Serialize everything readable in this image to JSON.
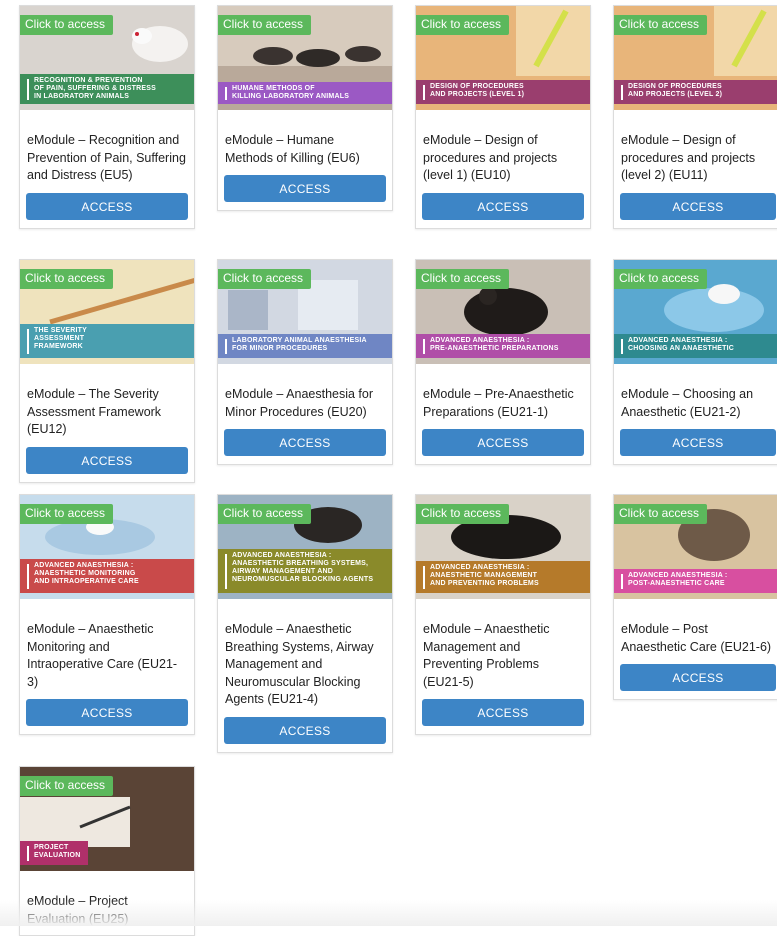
{
  "cards": [
    {
      "badge": "Click to access",
      "band": [
        "RECOGNITION & PREVENTION",
        "OF PAIN, SUFFERING & DISTRESS",
        "IN LABORATORY ANIMALS"
      ],
      "title": "eModule – Recognition and Prevention of Pain, Suffering and Distress (EU5)",
      "button": "ACCESS",
      "colors": {
        "bg": "#d9d4cf",
        "band": "#3d8f5a"
      }
    },
    {
      "badge": "Click to access",
      "band": [
        "HUMANE METHODS OF",
        "KILLING LABORATORY ANIMALS"
      ],
      "title": "eModule – Humane Methods of Killing (EU6)",
      "button": "ACCESS",
      "colors": {
        "bg": "#b9a99a",
        "band": "#9b59c4"
      }
    },
    {
      "badge": "Click to access",
      "band": [
        "DESIGN OF PROCEDURES",
        "AND PROJECTS (LEVEL 1)"
      ],
      "title": "eModule – Design of procedures and projects (level 1) (EU10)",
      "button": "ACCESS",
      "colors": {
        "bg": "#e8c27a",
        "band": "#9a3e6e"
      }
    },
    {
      "badge": "Click to access",
      "band": [
        "DESIGN OF PROCEDURES",
        "AND PROJECTS (LEVEL 2)"
      ],
      "title": "eModule – Design of procedures and projects (level 2) (EU11)",
      "button": "ACCESS",
      "colors": {
        "bg": "#e8c27a",
        "band": "#9a3e6e"
      }
    },
    {
      "badge": "Click to access",
      "band": [
        "THE SEVERITY",
        "ASSESSMENT",
        "FRAMEWORK"
      ],
      "title": "eModule – The Severity Assessment Framework (EU12)",
      "button": "ACCESS",
      "colors": {
        "bg": "#e9d9a8",
        "band": "#4a9fb0"
      }
    },
    {
      "badge": "Click to access",
      "band": [
        "LABORATORY ANIMAL ANAESTHESIA",
        "FOR MINOR PROCEDURES"
      ],
      "title": "eModule – Anaesthesia for Minor Procedures (EU20)",
      "button": "ACCESS",
      "colors": {
        "bg": "#c6ccd8",
        "band": "#6f86c4"
      }
    },
    {
      "badge": "Click to access",
      "band": [
        "ADVANCED ANAESTHESIA :",
        "PRE-ANAESTHETIC PREPARATIONS"
      ],
      "title": "eModule – Pre-Anaesthetic Preparations (EU21-1)",
      "button": "ACCESS",
      "colors": {
        "bg": "#7a6658",
        "band": "#b04ea8"
      }
    },
    {
      "badge": "Click to access",
      "band": [
        "ADVANCED ANAESTHESIA :",
        "CHOOSING AN ANAESTHETIC"
      ],
      "title": "eModule – Choosing an Anaesthetic (EU21-2)",
      "button": "ACCESS",
      "colors": {
        "bg": "#6ab3d6",
        "band": "#2e8a8f"
      }
    },
    {
      "badge": "Click to access",
      "band": [
        "ADVANCED ANAESTHESIA :",
        "ANAESTHETIC MONITORING",
        "AND INTRAOPERATIVE CARE"
      ],
      "title": "eModule – Anaesthetic Monitoring and Intraoperative Care (EU21-3)",
      "button": "ACCESS",
      "colors": {
        "bg": "#b8d3e8",
        "band": "#c94a4a"
      }
    },
    {
      "badge": "Click to access",
      "band": [
        "ADVANCED ANAESTHESIA :",
        "ANAESTHETIC BREATHING SYSTEMS,",
        "AIRWAY MANAGEMENT AND",
        "NEUROMUSCULAR BLOCKING AGENTS"
      ],
      "title": "eModule – Anaesthetic Breathing Systems, Airway Management and Neuromuscular Blocking Agents (EU21-4)",
      "button": "ACCESS",
      "colors": {
        "bg": "#8fa0b0",
        "band": "#8a8a2a"
      }
    },
    {
      "badge": "Click to access",
      "band": [
        "ADVANCED ANAESTHESIA :",
        "ANAESTHETIC MANAGEMENT",
        "AND PREVENTING PROBLEMS"
      ],
      "title": "eModule – Anaesthetic Management and Preventing Problems (EU21-5)",
      "button": "ACCESS",
      "colors": {
        "bg": "#4a4038",
        "band": "#b57a2a"
      }
    },
    {
      "badge": "Click to access",
      "band": [
        "ADVANCED ANAESTHESIA :",
        "POST-ANAESTHETIC CARE"
      ],
      "title": "eModule – Post Anaesthetic Care (EU21-6)",
      "button": "ACCESS",
      "colors": {
        "bg": "#c8b08a",
        "band": "#d84fa0"
      }
    },
    {
      "badge": "Click to access",
      "band": [
        "PROJECT",
        "EVALUATION"
      ],
      "title": "eModule – Project Evaluation (EU25)",
      "button": "",
      "colors": {
        "bg": "#7a5a48",
        "band": "#b0306a"
      }
    }
  ]
}
